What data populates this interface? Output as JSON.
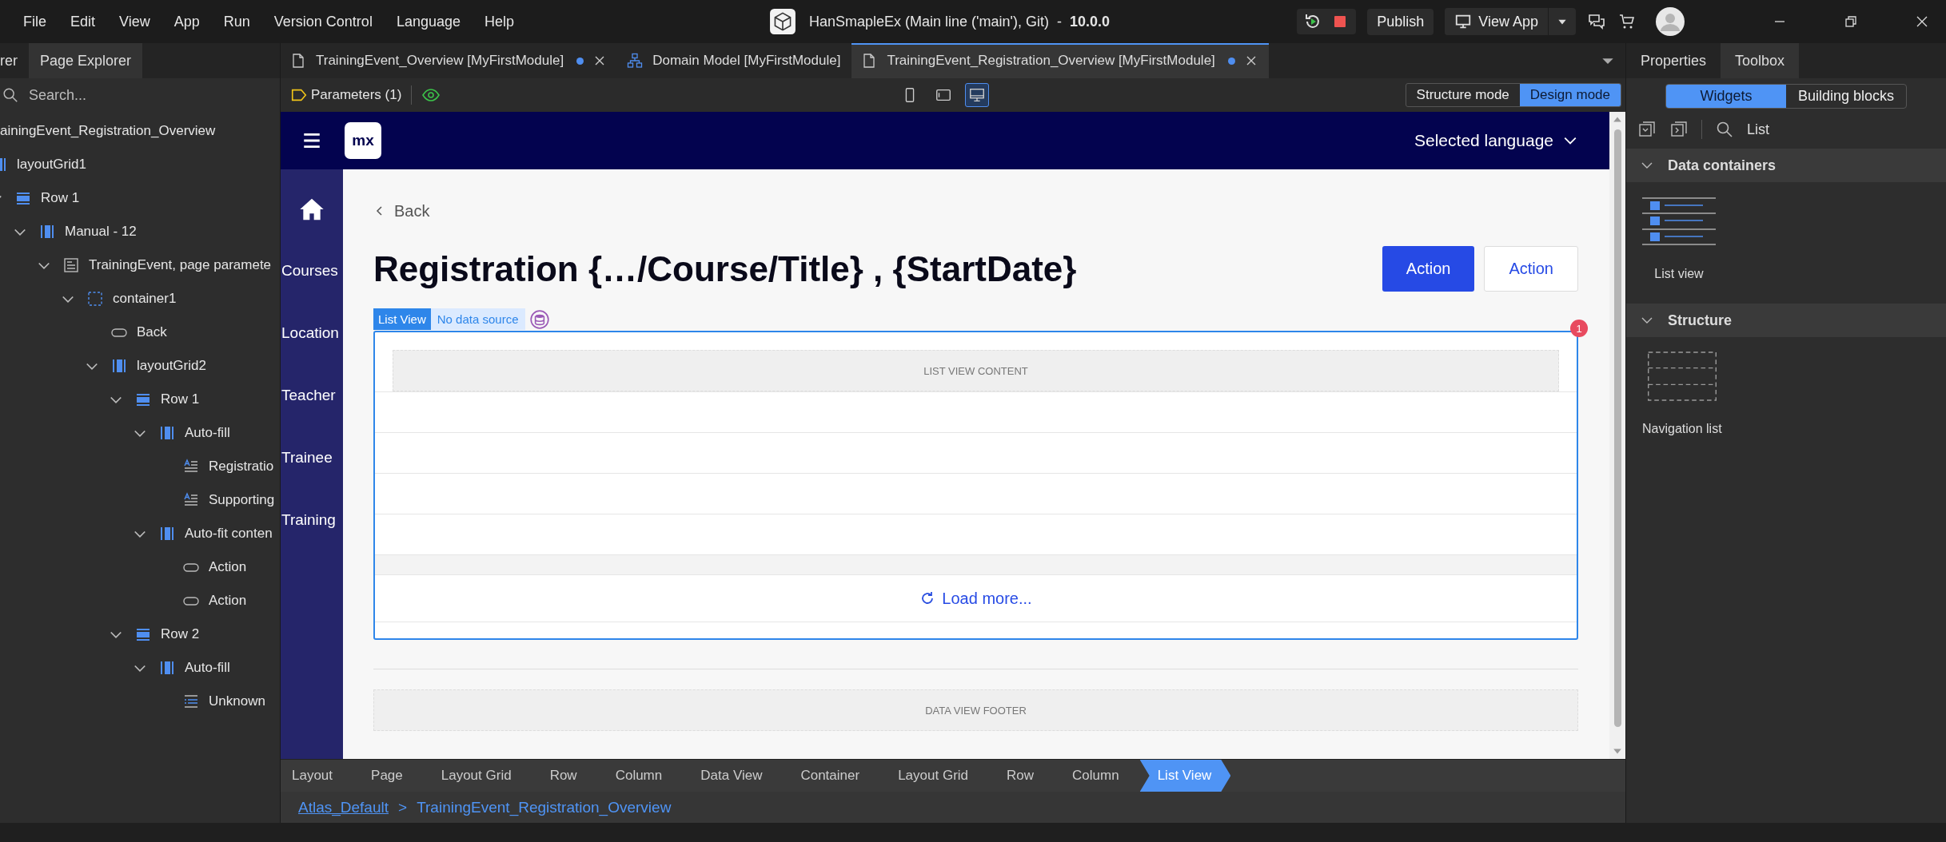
{
  "menu_bar": {
    "items": [
      "File",
      "Edit",
      "View",
      "App",
      "Run",
      "Version Control",
      "Language",
      "Help"
    ],
    "project": {
      "name": "HanSmapleEx (Main line ('main'), Git)",
      "separator": "-",
      "version": "10.0.0"
    },
    "publish_label": "Publish",
    "view_app_label": "View App"
  },
  "left_panel": {
    "tabs": [
      {
        "label": "rer",
        "selected": false
      },
      {
        "label": "Page Explorer",
        "selected": true
      }
    ],
    "search": {
      "placeholder": "Search..."
    },
    "tree": [
      {
        "label": "ainingEvent_Registration_Overview",
        "children": [
          {
            "label": "layoutGrid1",
            "kind": "grid",
            "children": [
              {
                "label": "Row 1",
                "kind": "row",
                "expanded": true,
                "children": [
                  {
                    "label": "Manual - 12",
                    "kind": "column",
                    "expanded": true,
                    "children": [
                      {
                        "label": "TrainingEvent, page paramete",
                        "kind": "dataview",
                        "expanded": true,
                        "children": [
                          {
                            "label": "container1",
                            "kind": "container",
                            "expanded": true,
                            "children": [
                              {
                                "label": "Back",
                                "kind": "button"
                              },
                              {
                                "label": "layoutGrid2",
                                "kind": "grid",
                                "expanded": true,
                                "children": [
                                  {
                                    "label": "Row 1",
                                    "kind": "row",
                                    "expanded": true,
                                    "children": [
                                      {
                                        "label": "Auto-fill",
                                        "kind": "column",
                                        "expanded": true,
                                        "children": [
                                          {
                                            "label": "Registratio",
                                            "kind": "text"
                                          },
                                          {
                                            "label": "Supporting",
                                            "kind": "text"
                                          }
                                        ]
                                      },
                                      {
                                        "label": "Auto-fit conten",
                                        "kind": "column",
                                        "expanded": true,
                                        "children": [
                                          {
                                            "label": "Action",
                                            "kind": "button"
                                          },
                                          {
                                            "label": "Action",
                                            "kind": "button"
                                          }
                                        ]
                                      }
                                    ]
                                  },
                                  {
                                    "label": "Row 2",
                                    "kind": "row",
                                    "expanded": true,
                                    "children": [
                                      {
                                        "label": "Auto-fill",
                                        "kind": "column",
                                        "expanded": true,
                                        "children": [
                                          {
                                            "label": "Unknown",
                                            "kind": "listview"
                                          }
                                        ]
                                      }
                                    ]
                                  }
                                ]
                              }
                            ]
                          }
                        ]
                      }
                    ]
                  }
                ]
              }
            ]
          }
        ]
      }
    ]
  },
  "editor_tabs": [
    {
      "label": "TrainingEvent_Overview [MyFirstModule]",
      "kind": "page",
      "unsaved": true,
      "closable": true,
      "selected": false
    },
    {
      "label": "Domain Model [MyFirstModule]",
      "kind": "model",
      "unsaved": false,
      "closable": false,
      "selected": false
    },
    {
      "label": "TrainingEvent_Registration_Overview [MyFirstModule]",
      "kind": "page",
      "unsaved": true,
      "closable": true,
      "selected": true
    }
  ],
  "toolbar": {
    "parameters": "Parameters (1)",
    "devices": [
      {
        "kind": "phone",
        "selected": false
      },
      {
        "kind": "tablet",
        "selected": false
      },
      {
        "kind": "desktop",
        "selected": true
      }
    ],
    "modes": [
      {
        "label": "Structure mode",
        "selected": false
      },
      {
        "label": "Design mode",
        "selected": true
      }
    ]
  },
  "canvas": {
    "logo": "mx",
    "language": "Selected language",
    "nav": [
      "Courses",
      "Location",
      "Teacher",
      "Trainee",
      "Training"
    ],
    "back": "Back",
    "title": "Registration {…/Course/Title} , {StartDate}",
    "actions": [
      {
        "label": "Action",
        "kind": "primary"
      },
      {
        "label": "Action",
        "kind": "secondary"
      }
    ],
    "list_view": {
      "tag": "List View",
      "source": "No data source",
      "error_count": "1",
      "content": "LIST VIEW CONTENT",
      "load_more": "Load more..."
    },
    "footer": "DATA VIEW FOOTER"
  },
  "breadcrumb": [
    {
      "label": "Layout",
      "selected": false
    },
    {
      "label": "Page",
      "selected": false
    },
    {
      "label": "Layout Grid",
      "selected": false
    },
    {
      "label": "Row",
      "selected": false
    },
    {
      "label": "Column",
      "selected": false
    },
    {
      "label": "Data View",
      "selected": false
    },
    {
      "label": "Container",
      "selected": false
    },
    {
      "label": "Layout Grid",
      "selected": false
    },
    {
      "label": "Row",
      "selected": false
    },
    {
      "label": "Column",
      "selected": false
    },
    {
      "label": "List View",
      "selected": true
    }
  ],
  "path": {
    "link": "Atlas_Default",
    "separator": ">",
    "page": "TrainingEvent_Registration_Overview"
  },
  "right_panel": {
    "tabs": [
      {
        "label": "Properties",
        "selected": false
      },
      {
        "label": "Toolbox",
        "selected": true
      }
    ],
    "segments": [
      {
        "label": "Widgets",
        "selected": true
      },
      {
        "label": "Building blocks",
        "selected": false
      }
    ],
    "search": {
      "value": "List"
    },
    "sections": [
      {
        "title": "Data containers",
        "expanded": true,
        "items": [
          {
            "label": "List view",
            "kind": "listview"
          }
        ]
      },
      {
        "title": "Structure",
        "expanded": true,
        "items": [
          {
            "label": "Navigation list",
            "kind": "navlist"
          }
        ]
      }
    ]
  }
}
